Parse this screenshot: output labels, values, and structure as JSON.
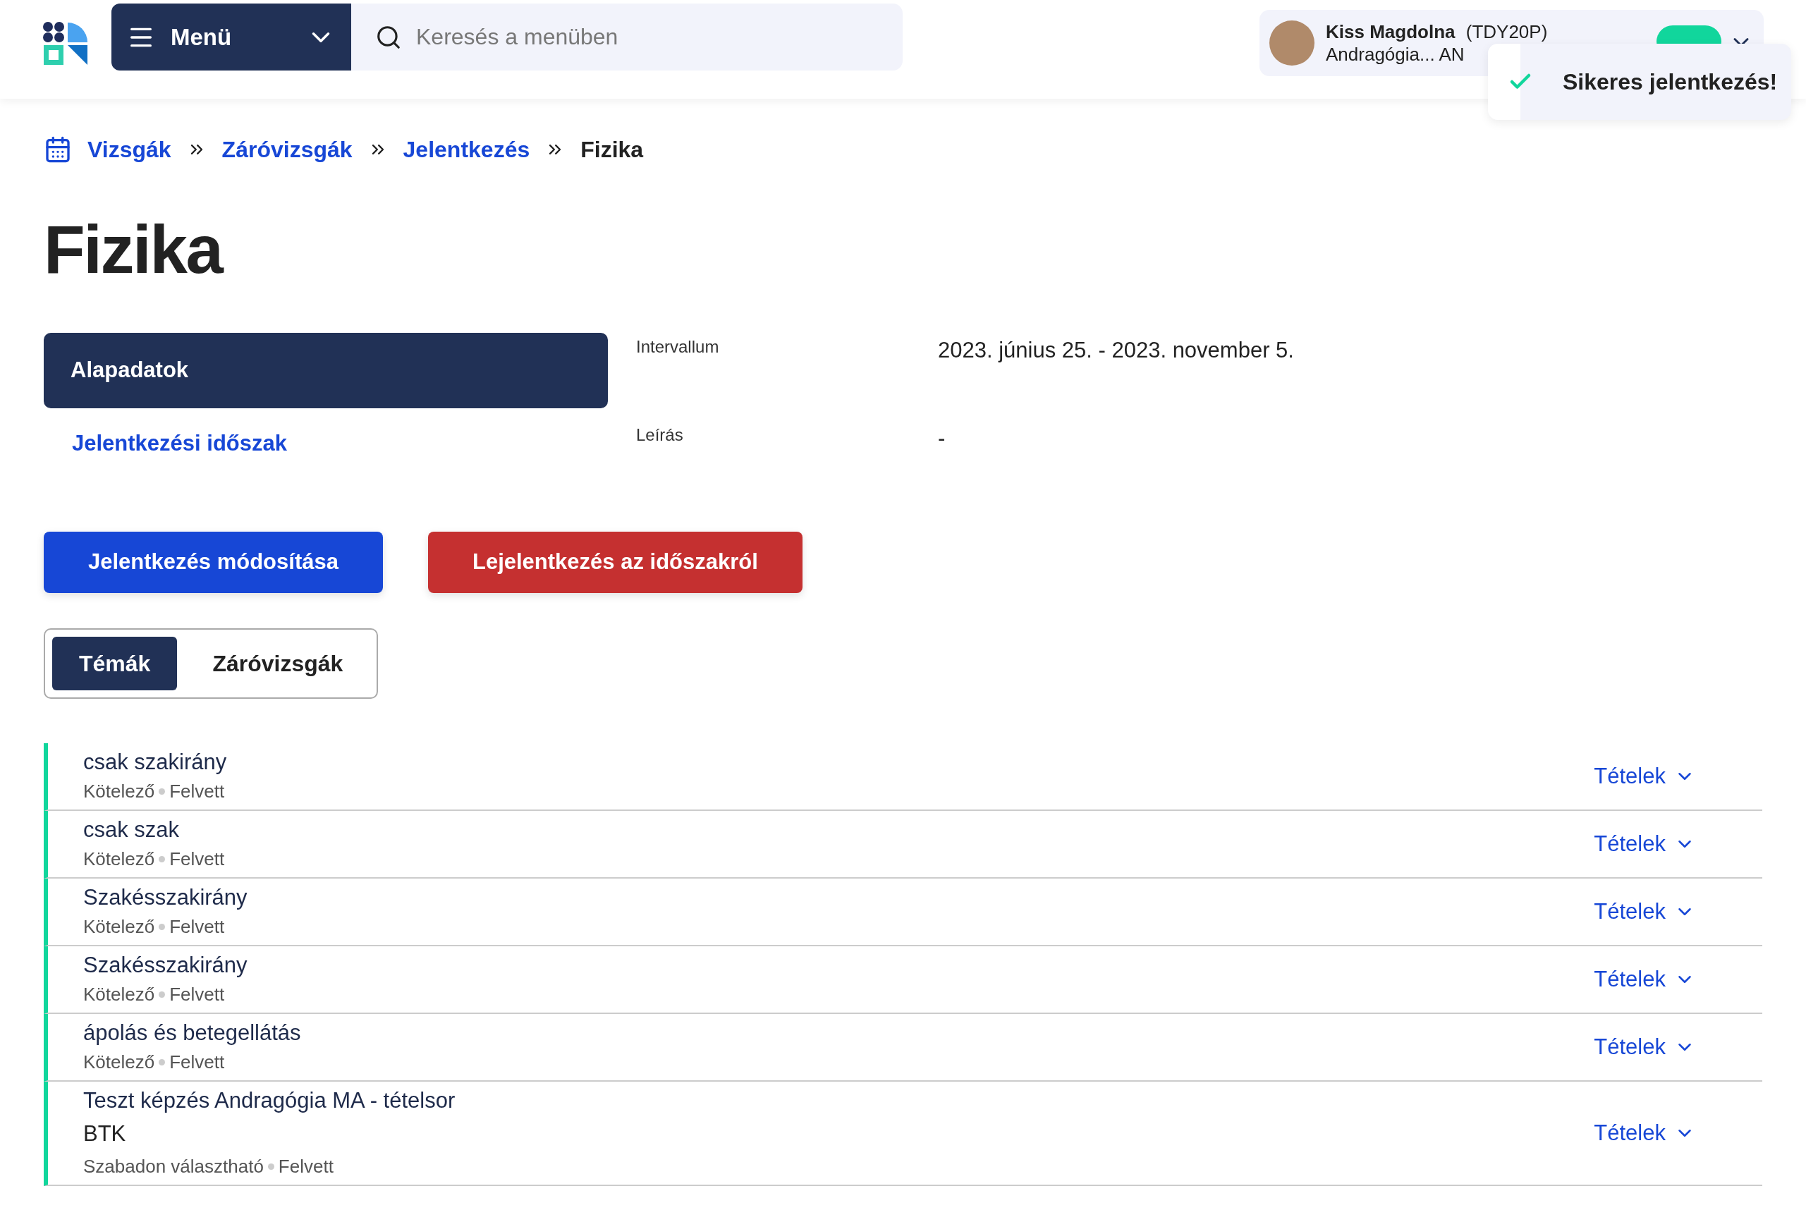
{
  "header": {
    "menu_label": "Menü",
    "search": {
      "placeholder": "Keresés a menüben"
    },
    "user": {
      "name": "Kiss Magdolna",
      "code": "(TDY20P)",
      "subtitle": "Andragógia... AN"
    }
  },
  "toast": {
    "message": "Sikeres jelentkezés!"
  },
  "breadcrumb": [
    {
      "label": "Vizsgák",
      "kind": "link"
    },
    {
      "label": "Záróvizsgák",
      "kind": "link"
    },
    {
      "label": "Jelentkezés",
      "kind": "link"
    },
    {
      "label": "Fizika",
      "kind": "current"
    }
  ],
  "title": "Fizika",
  "side_nav": [
    {
      "label": "Alapadatok",
      "selected": true
    },
    {
      "label": "Jelentkezési időszak",
      "selected": false
    }
  ],
  "details": [
    {
      "label": "Intervallum",
      "value": "2023. június 25. - 2023. november 5."
    },
    {
      "label": "Leírás",
      "value": "-"
    }
  ],
  "actions": [
    {
      "label": "Jelentkezés módosítása",
      "kind": "primary"
    },
    {
      "label": "Lejelentkezés az időszakról",
      "kind": "danger"
    }
  ],
  "tabs": [
    {
      "label": "Témák",
      "selected": true
    },
    {
      "label": "Záróvizsgák",
      "selected": false
    }
  ],
  "topics": [
    {
      "title": "csak szakirány",
      "type": "Kötelező",
      "status": "Felvett",
      "toggle": "Tételek"
    },
    {
      "title": "csak szak",
      "type": "Kötelező",
      "status": "Felvett",
      "toggle": "Tételek"
    },
    {
      "title": "Szakésszakirány",
      "type": "Kötelező",
      "status": "Felvett",
      "toggle": "Tételek"
    },
    {
      "title": "Szakésszakirány",
      "type": "Kötelező",
      "status": "Felvett",
      "toggle": "Tételek"
    },
    {
      "title": "ápolás és betegellátás",
      "type": "Kötelező",
      "status": "Felvett",
      "toggle": "Tételek"
    },
    {
      "title": "Teszt képzés Andragógia MA - tételsor",
      "extra": "BTK",
      "type": "Szabadon választható",
      "status": "Felvett",
      "toggle": "Tételek"
    }
  ]
}
